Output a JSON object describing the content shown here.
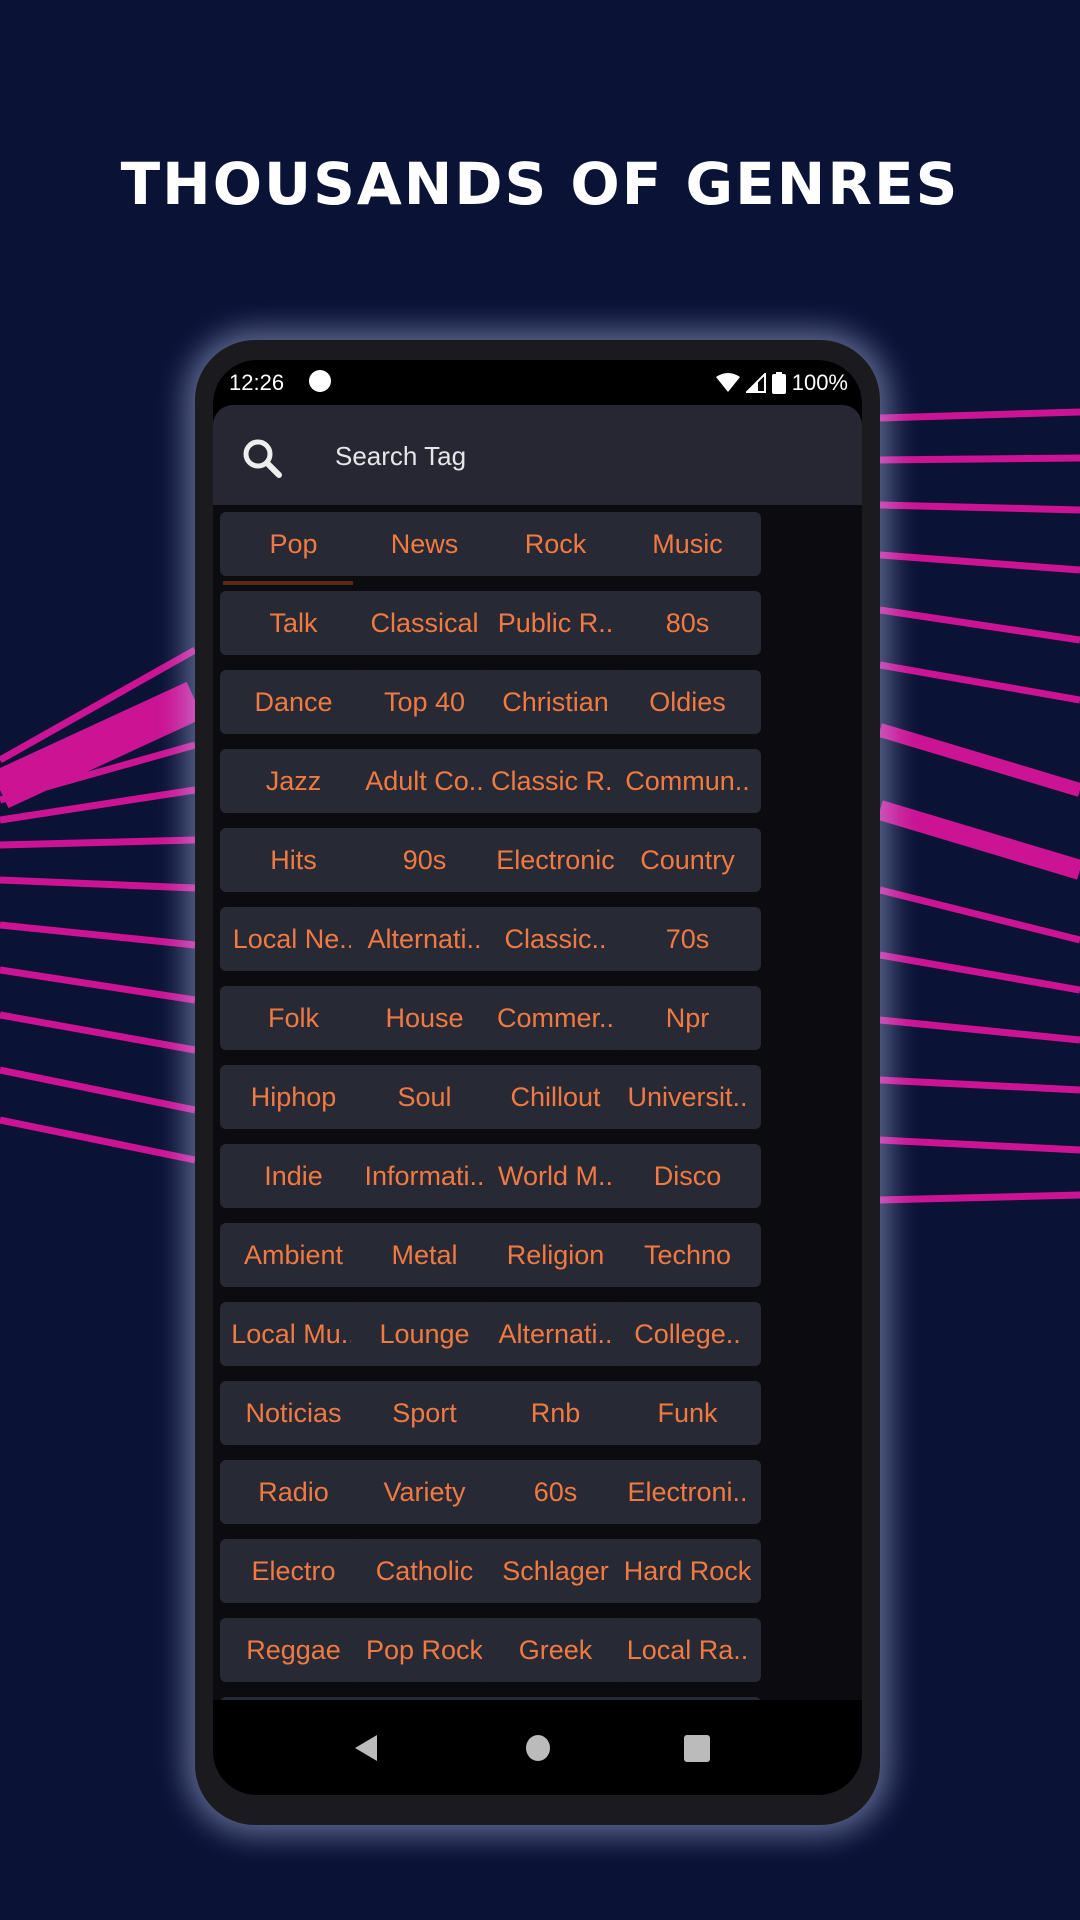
{
  "headline": "THOUSANDS OF GENRES",
  "colors": {
    "background": "#0a1236",
    "accent_lines": "#d6149a",
    "tag_text": "#f07a42",
    "tag_bg": "#272934"
  },
  "status_bar": {
    "time": "12:26",
    "battery": "100%",
    "icons": [
      "notification-icon",
      "wifi-icon",
      "signal-icon",
      "battery-icon"
    ]
  },
  "search": {
    "placeholder": "Search Tag",
    "icon": "search-icon"
  },
  "tags": [
    "Pop",
    "News",
    "Rock",
    "Music",
    "Talk",
    "Classical",
    "Public R..",
    "80s",
    "Dance",
    "Top 40",
    "Christian",
    "Oldies",
    "Jazz",
    "Adult Co..",
    "Classic R..",
    "Commun..",
    "Hits",
    "90s",
    "Electronic",
    "Country",
    "Local Ne..",
    "Alternati..",
    "Classic..",
    "70s",
    "Folk",
    "House",
    "Commer..",
    "Npr",
    "Hiphop",
    "Soul",
    "Chillout",
    "Universit..",
    "Indie",
    "Informati..",
    "World M..",
    "Disco",
    "Ambient",
    "Metal",
    "Religion",
    "Techno",
    "Local Mu..",
    "Lounge",
    "Alternati..",
    "College..",
    "Noticias",
    "Sport",
    "Rnb",
    "Funk",
    "Radio",
    "Variety",
    "60s",
    "Electroni..",
    "Electro",
    "Catholic",
    "Schlager",
    "Hard Rock",
    "Reggae",
    "Pop Rock",
    "Greek",
    "Local Ra..",
    "",
    "",
    "",
    ""
  ],
  "nav": {
    "back": "back-icon",
    "home": "home-icon",
    "recents": "recents-icon"
  }
}
